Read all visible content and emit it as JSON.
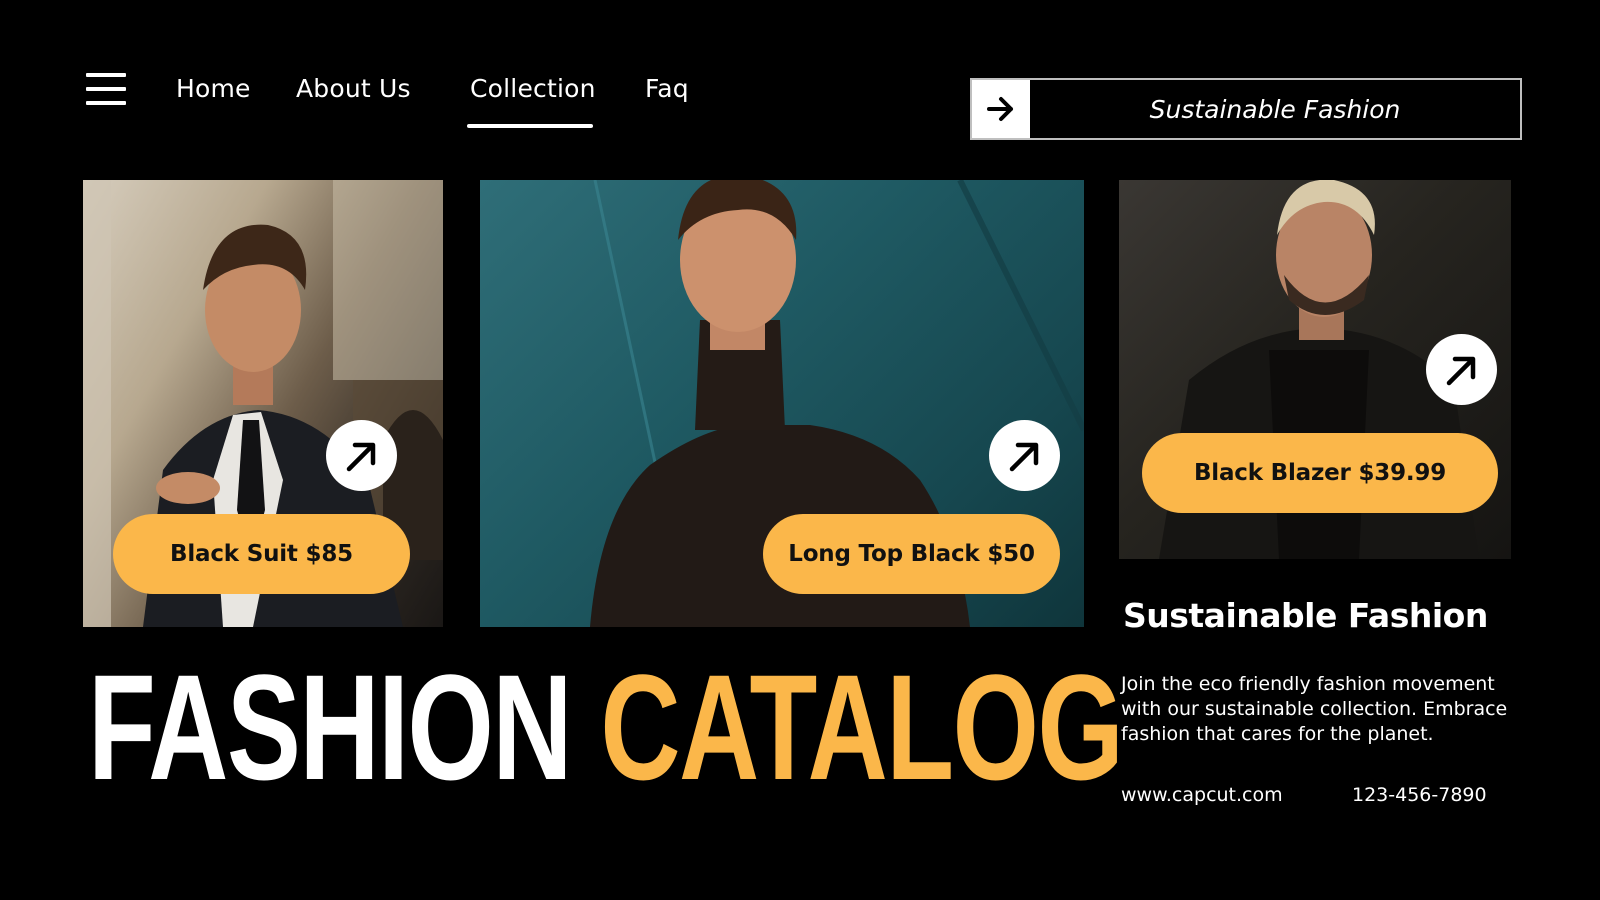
{
  "header": {
    "menu_icon": "hamburger-menu-icon",
    "nav": [
      {
        "label": "Home",
        "active": false
      },
      {
        "label": "About Us",
        "active": false
      },
      {
        "label": "Collection",
        "active": true
      },
      {
        "label": "Faq",
        "active": false
      }
    ],
    "search": {
      "icon": "arrow-right-icon",
      "text": "Sustainable Fashion"
    }
  },
  "products": [
    {
      "label": "Black Suit $85",
      "icon": "arrow-up-right-icon"
    },
    {
      "label": "Long Top Black $50",
      "icon": "arrow-up-right-icon"
    },
    {
      "label": "Black Blazer $39.99",
      "icon": "arrow-up-right-icon"
    }
  ],
  "title": {
    "part1": "FASHION",
    "part2": "CATALOG"
  },
  "info": {
    "heading": "Sustainable Fashion",
    "body": "Join the eco friendly fashion movement with our sustainable collection. Embrace fashion that cares for the planet.",
    "website": "www.capcut.com",
    "phone": "123-456-7890"
  },
  "colors": {
    "background": "#000000",
    "accent": "#fbb74a",
    "text": "#ffffff"
  }
}
